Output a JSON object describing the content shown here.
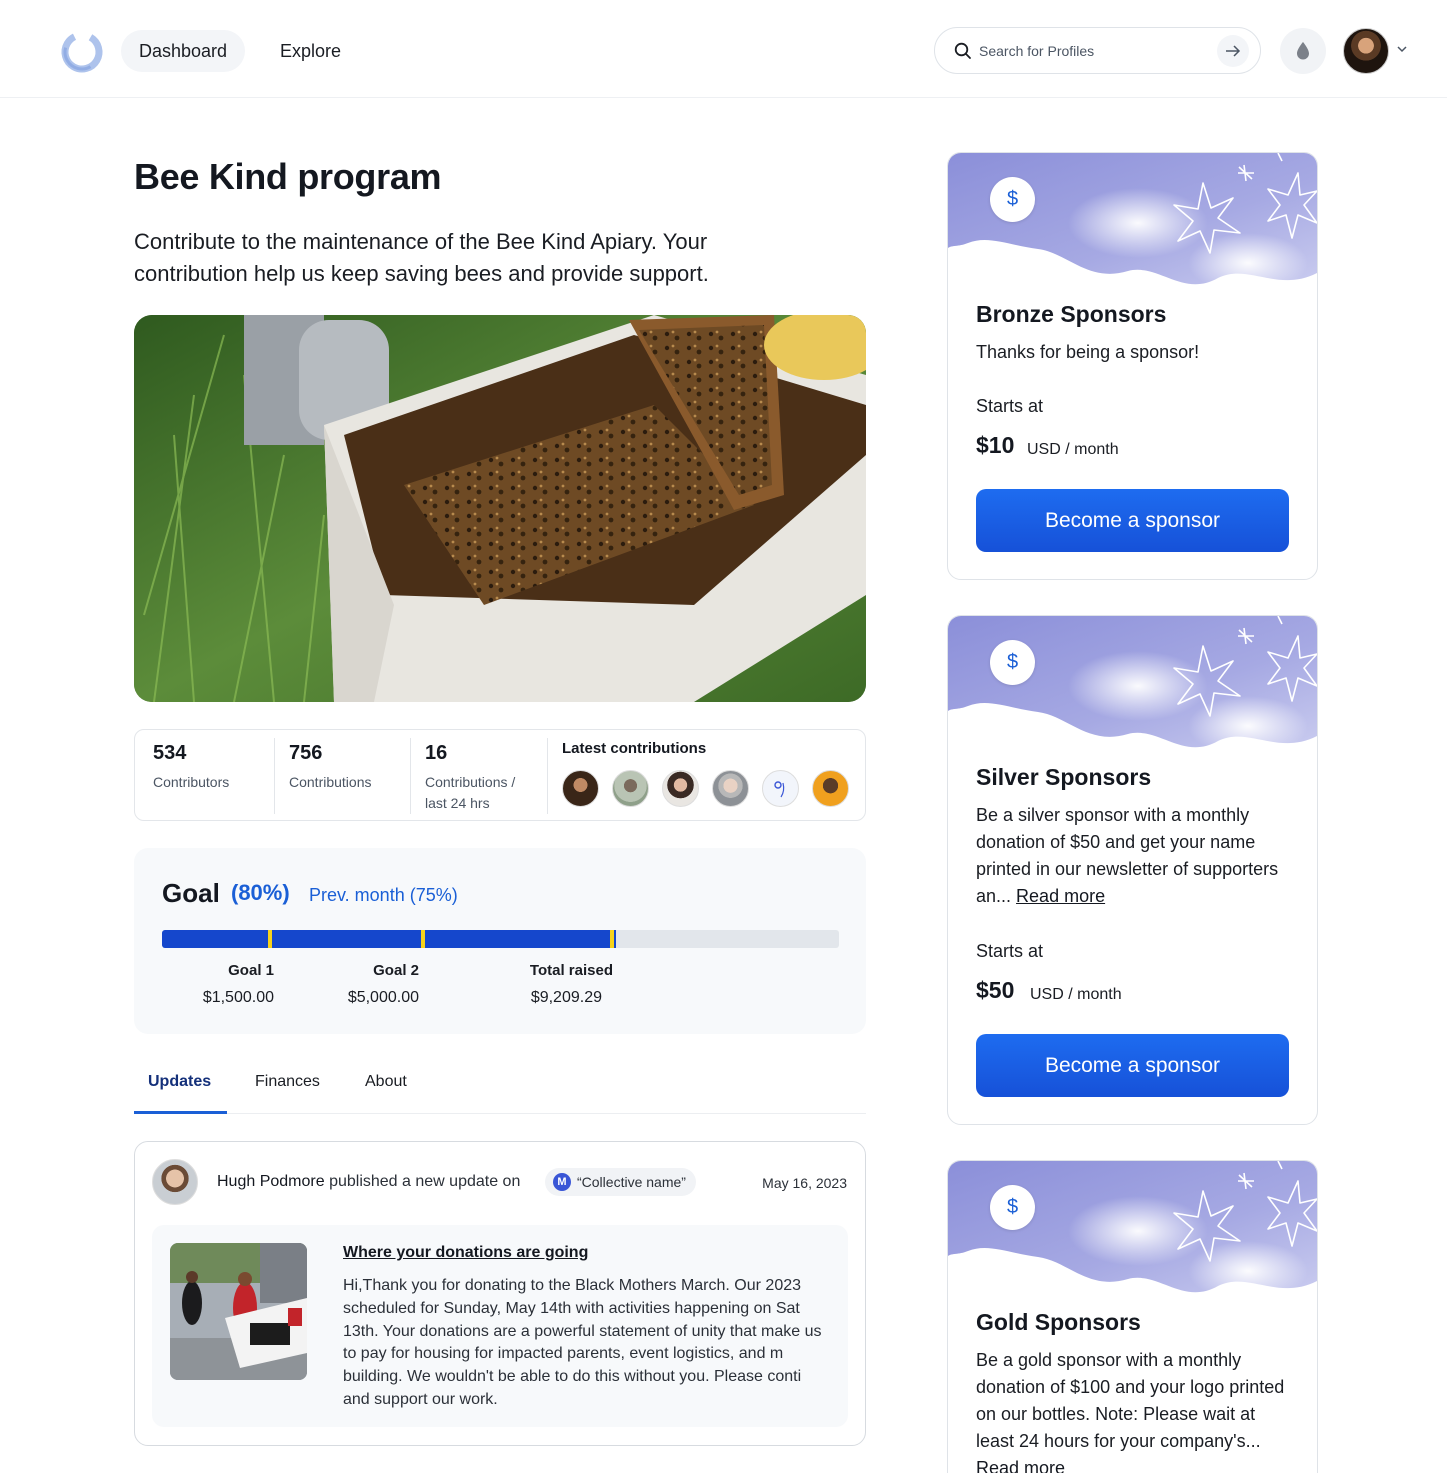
{
  "nav": {
    "dashboard": "Dashboard",
    "explore": "Explore",
    "search_placeholder": "Search for Profiles"
  },
  "program": {
    "title": "Bee Kind program",
    "description": "Contribute to the maintenance of the Bee Kind Apiary. Your contribution help us keep saving bees and provide support."
  },
  "stats": {
    "contributors_count": "534",
    "contributors_label": "Contributors",
    "contributions_count": "756",
    "contributions_label": "Contributions",
    "recent_count": "16",
    "recent_label": "Contributions / last 24 hrs",
    "latest_title": "Latest contributions"
  },
  "goal": {
    "title": "Goal",
    "percent": "(80%)",
    "prev": "Prev. month (75%)",
    "progress_fraction": 0.67,
    "markers": [
      0.16,
      0.385,
      0.665
    ],
    "items": [
      {
        "label": "Goal 1",
        "value": "$1,500.00"
      },
      {
        "label": "Goal 2",
        "value": "$5,000.00"
      },
      {
        "label": "Total raised",
        "value": "$9,209.29"
      }
    ]
  },
  "tabs": [
    "Updates",
    "Finances",
    "About"
  ],
  "update": {
    "author": "Hugh Podmore",
    "action": "published a new update on",
    "collective": "“Collective name”",
    "collective_initial": "M",
    "date": "May 16, 2023",
    "heading": "Where your donations are going",
    "body": "Hi,Thank you for donating to the Black Mothers March. Our 2023 scheduled for Sunday, May 14th with activities happening on Sat 13th. Your donations are a powerful statement of unity that make us to pay for housing for impacted parents, event logistics, and m building. We wouldn't be able to do this without you. Please conti and support our work."
  },
  "sponsors": [
    {
      "name": "Bronze Sponsors",
      "text": "Thanks for being a sponsor!",
      "starts": "Starts at",
      "price": "$10",
      "unit": "USD / month",
      "button": "Become a sponsor"
    },
    {
      "name": "Silver Sponsors",
      "text": "Be a silver sponsor with a monthly donation of $50 and get your name printed in our newsletter of supporters an...",
      "read_more": "Read more",
      "starts": "Starts at",
      "price": "$50",
      "unit": "USD / month",
      "button": "Become a sponsor"
    },
    {
      "name": "Gold Sponsors",
      "text": "Be a gold sponsor with a monthly donation of $100 and your logo printed on our bottles. Note: Please wait at least 24 hours for your company's...",
      "read_more": "Read more"
    }
  ],
  "icons": {
    "sponsor_icon": "$",
    "accent": "#1a5fd6",
    "goal_fill": "#1547cc",
    "goal_marker": "#f6d31c"
  }
}
